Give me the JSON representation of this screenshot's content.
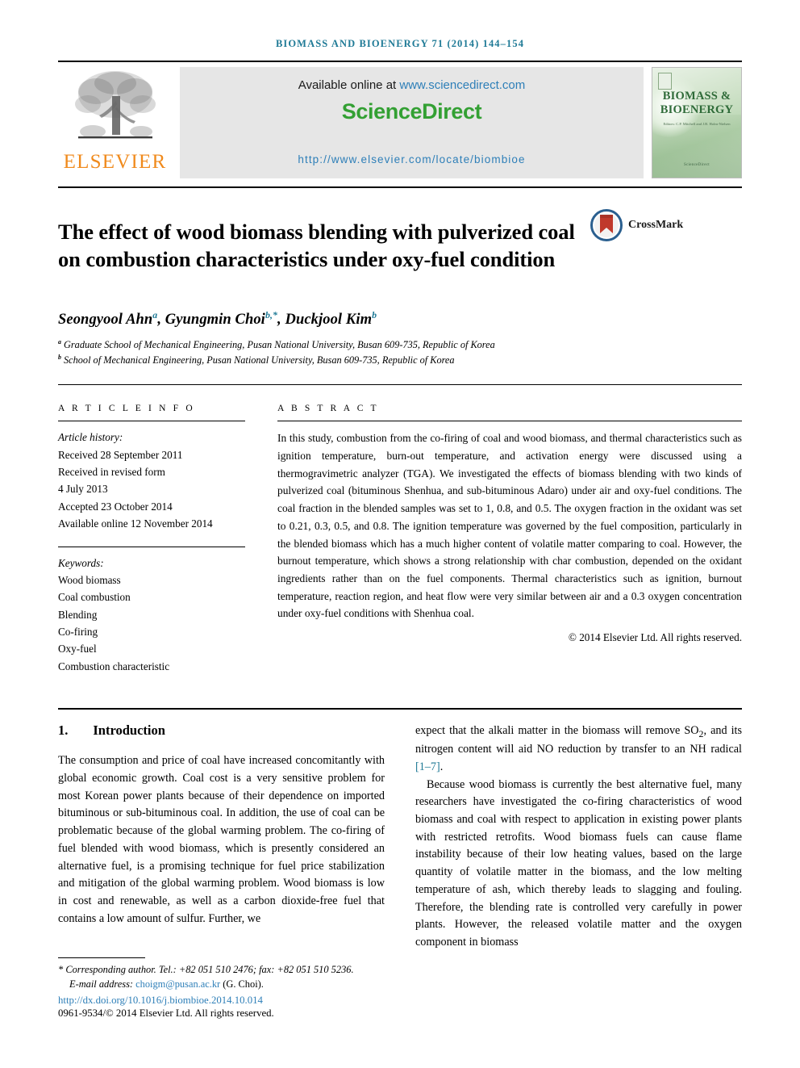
{
  "running_head": "BIOMASS AND BIOENERGY 71 (2014) 144–154",
  "masthead": {
    "publisher_name": "ELSEVIER",
    "available_online_label": "Available online at",
    "sciencedirect_url": "www.sciencedirect.com",
    "sciencedirect_wordmark": "ScienceDirect",
    "journal_homepage_url": "http://www.elsevier.com/locate/biombioe",
    "cover": {
      "title_line1": "BIOMASS &",
      "title_line2": "BIOENERGY",
      "subtitle": "Editors: C.P. Mitchell and J.B. Holm-Nielsen",
      "footer": "ScienceDirect"
    }
  },
  "article": {
    "title": "The effect of wood biomass blending with pulverized coal on combustion characteristics under oxy-fuel condition",
    "crossmark_label": "CrossMark",
    "authors": [
      {
        "name": "Seongyool Ahn",
        "marks": "a"
      },
      {
        "name": "Gyungmin Choi",
        "marks": "b,*"
      },
      {
        "name": "Duckjool Kim",
        "marks": "b"
      }
    ],
    "affiliations": [
      {
        "mark": "a",
        "text": "Graduate School of Mechanical Engineering, Pusan National University, Busan 609-735, Republic of Korea"
      },
      {
        "mark": "b",
        "text": "School of Mechanical Engineering, Pusan National University, Busan 609-735, Republic of Korea"
      }
    ]
  },
  "article_info": {
    "heading": "A R T I C L E   I N F O",
    "history_label": "Article history:",
    "history": [
      "Received 28 September 2011",
      "Received in revised form",
      "4 July 2013",
      "Accepted 23 October 2014",
      "Available online 12 November 2014"
    ],
    "keywords_label": "Keywords:",
    "keywords": [
      "Wood biomass",
      "Coal combustion",
      "Blending",
      "Co-firing",
      "Oxy-fuel",
      "Combustion characteristic"
    ]
  },
  "abstract": {
    "heading": "A B S T R A C T",
    "text": "In this study, combustion from the co-firing of coal and wood biomass, and thermal characteristics such as ignition temperature, burn-out temperature, and activation energy were discussed using a thermogravimetric analyzer (TGA). We investigated the effects of biomass blending with two kinds of pulverized coal (bituminous Shenhua, and sub-bituminous Adaro) under air and oxy-fuel conditions. The coal fraction in the blended samples was set to 1, 0.8, and 0.5. The oxygen fraction in the oxidant was set to 0.21, 0.3, 0.5, and 0.8. The ignition temperature was governed by the fuel composition, particularly in the blended biomass which has a much higher content of volatile matter comparing to coal. However, the burnout temperature, which shows a strong relationship with char combustion, depended on the oxidant ingredients rather than on the fuel components. Thermal characteristics such as ignition, burnout temperature, reaction region, and heat flow were very similar between air and a 0.3 oxygen concentration under oxy-fuel conditions with Shenhua coal.",
    "copyright": "© 2014 Elsevier Ltd. All rights reserved."
  },
  "body": {
    "section_number": "1.",
    "section_title": "Introduction",
    "left_paragraph": "The consumption and price of coal have increased concomitantly with global economic growth. Coal cost is a very sensitive problem for most Korean power plants because of their dependence on imported bituminous or sub-bituminous coal. In addition, the use of coal can be problematic because of the global warming problem. The co-firing of fuel blended with wood biomass, which is presently considered an alternative fuel, is a promising technique for fuel price stabilization and mitigation of the global warming problem. Wood biomass is low in cost and renewable, as well as a carbon dioxide-free fuel that contains a low amount of sulfur. Further, we",
    "right_paragraph_1_pre": "expect that the alkali matter in the biomass will remove SO",
    "right_paragraph_1_sub": "2",
    "right_paragraph_1_post": ", and its nitrogen content will aid NO reduction by transfer to an NH radical ",
    "right_citation": "[1–7]",
    "right_paragraph_1_end": ".",
    "right_paragraph_2": "Because wood biomass is currently the best alternative fuel, many researchers have investigated the co-firing characteristics of wood biomass and coal with respect to application in existing power plants with restricted retrofits. Wood biomass fuels can cause flame instability because of their low heating values, based on the large quantity of volatile matter in the biomass, and the low melting temperature of ash, which thereby leads to slagging and fouling. Therefore, the blending rate is controlled very carefully in power plants. However, the released volatile matter and the oxygen component in biomass"
  },
  "footnotes": {
    "corresponding_author": "Corresponding author. Tel.: +82 051 510 2476; fax: +82 051 510 5236.",
    "email_label": "E-mail address:",
    "email": "choigm@pusan.ac.kr",
    "email_owner": "(G. Choi).",
    "doi": "http://dx.doi.org/10.1016/j.biombioe.2014.10.014",
    "issn_copyright": "0961-9534/© 2014 Elsevier Ltd. All rights reserved."
  },
  "colors": {
    "accent_teal": "#1f7a96",
    "link_blue": "#2e7fb8",
    "sciencedirect_green": "#33a033",
    "elsevier_orange": "#f08a1c",
    "cover_green": "#2f6b39"
  }
}
